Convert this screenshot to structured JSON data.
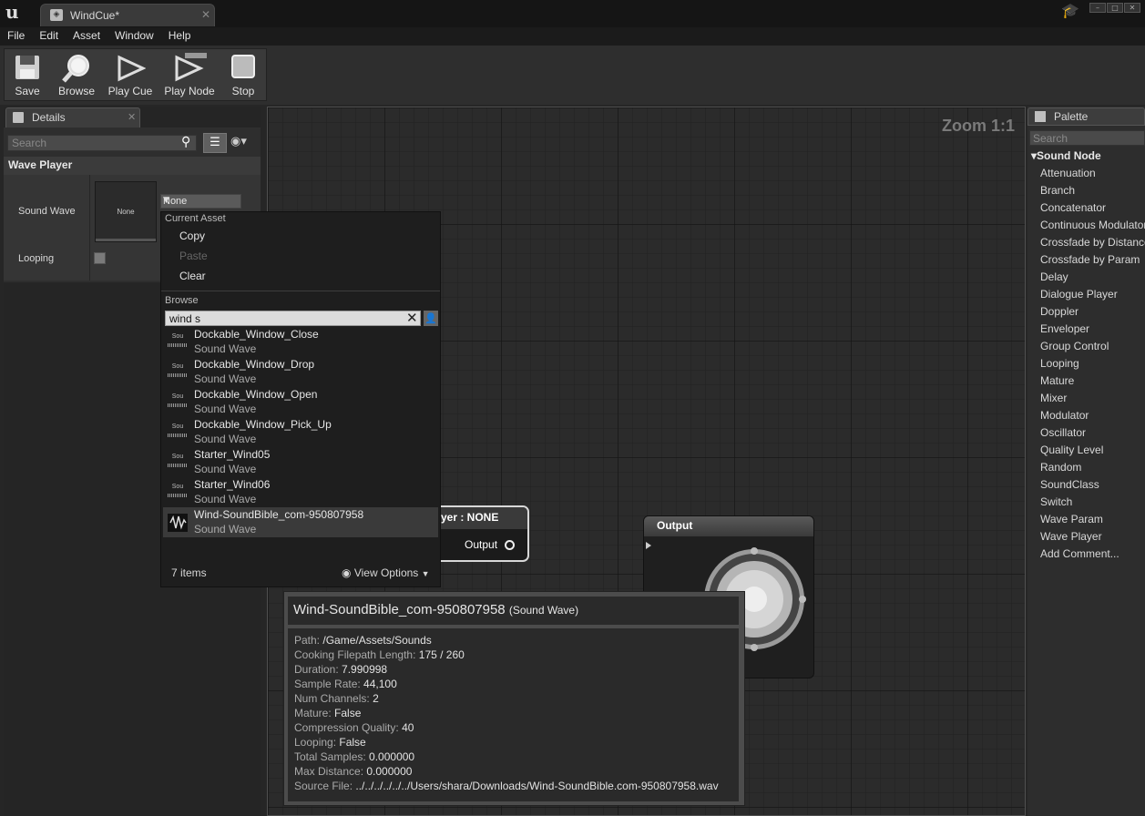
{
  "title_tab": {
    "label": "WindCue*"
  },
  "menu": [
    "File",
    "Edit",
    "Asset",
    "Window",
    "Help"
  ],
  "toolbar": {
    "save": "Save",
    "browse": "Browse",
    "play_cue": "Play Cue",
    "play_node": "Play Node",
    "stop": "Stop"
  },
  "details": {
    "tab_label": "Details",
    "search_placeholder": "Search",
    "category": "Wave Player",
    "sound_wave_label": "Sound Wave",
    "sound_wave_thumb": "None",
    "sound_wave_value": "None",
    "looping_label": "Looping"
  },
  "graph": {
    "zoom": "Zoom 1:1",
    "wave_player_node": {
      "title": "yer : NONE",
      "output": "Output"
    },
    "output_node": {
      "title": "Output"
    }
  },
  "palette": {
    "tab_label": "Palette",
    "search_placeholder": "Search",
    "category": "Sound Node",
    "items": [
      "Attenuation",
      "Branch",
      "Concatenator",
      "Continuous Modulator",
      "Crossfade by Distance",
      "Crossfade by Param",
      "Delay",
      "Dialogue Player",
      "Doppler",
      "Enveloper",
      "Group Control",
      "Looping",
      "Mature",
      "Mixer",
      "Modulator",
      "Oscillator",
      "Quality Level",
      "Random",
      "SoundClass",
      "Switch",
      "Wave Param",
      "Wave Player",
      "Add Comment..."
    ]
  },
  "dropdown": {
    "current_asset_header": "Current Asset",
    "copy": "Copy",
    "paste": "Paste",
    "clear": "Clear",
    "browse_header": "Browse",
    "search_value": "wind s",
    "thumb_label": "Sou",
    "assets": [
      {
        "name": "Dockable_Window_Close",
        "type": "Sound Wave"
      },
      {
        "name": "Dockable_Window_Drop",
        "type": "Sound Wave"
      },
      {
        "name": "Dockable_Window_Open",
        "type": "Sound Wave"
      },
      {
        "name": "Dockable_Window_Pick_Up",
        "type": "Sound Wave"
      },
      {
        "name": "Starter_Wind05",
        "type": "Sound Wave"
      },
      {
        "name": "Starter_Wind06",
        "type": "Sound Wave"
      },
      {
        "name": "Wind-SoundBible_com-950807958",
        "type": "Sound Wave"
      }
    ],
    "count": "7 items",
    "view_options": "View Options"
  },
  "tooltip": {
    "name": "Wind-SoundBible_com-950807958",
    "kind": "(Sound Wave)",
    "rows": [
      {
        "k": "Path:",
        "v": "/Game/Assets/Sounds"
      },
      {
        "k": "Cooking Filepath Length:",
        "v": "175 / 260"
      },
      {
        "k": "Duration:",
        "v": "7.990998"
      },
      {
        "k": "Sample Rate:",
        "v": "44,100"
      },
      {
        "k": "Num Channels:",
        "v": "2"
      },
      {
        "k": "Mature:",
        "v": "False"
      },
      {
        "k": "Compression Quality:",
        "v": "40"
      },
      {
        "k": "Looping:",
        "v": "False"
      },
      {
        "k": "Total Samples:",
        "v": "0.000000"
      },
      {
        "k": "Max Distance:",
        "v": "0.000000"
      },
      {
        "k": "Source File:",
        "v": "../../../../../../Users/shara/Downloads/Wind-SoundBible.com-950807958.wav"
      }
    ]
  }
}
